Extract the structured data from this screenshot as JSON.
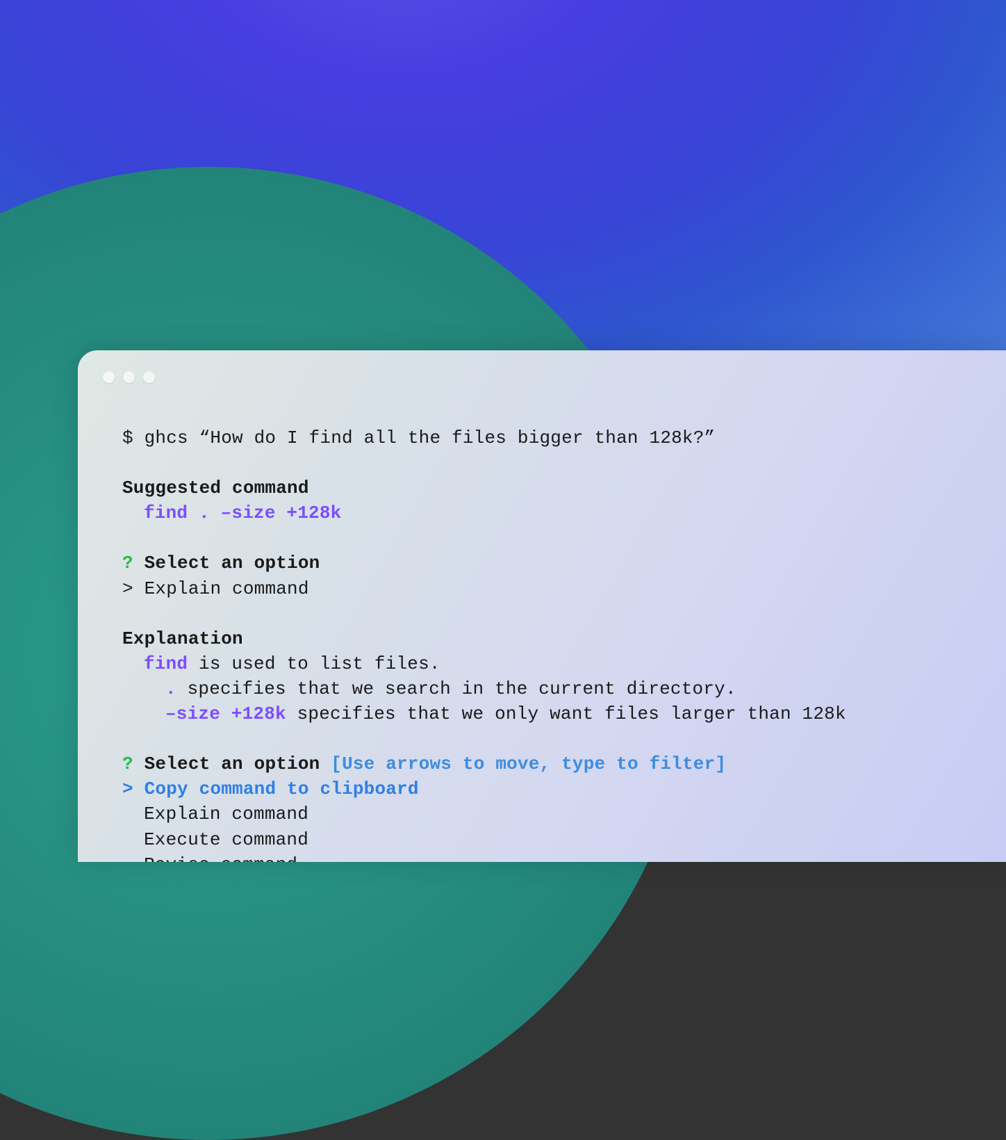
{
  "prompt_line": "$ ghcs “How do I find all the files bigger than 128k?”",
  "suggested": {
    "heading": "Suggested command",
    "command": "find . –size +128k"
  },
  "select1": {
    "q": "?",
    "label": "Select an option",
    "cursor": ">",
    "choice": "Explain command"
  },
  "explanation": {
    "heading": "Explanation",
    "l1_cmd": "find",
    "l1_text": " is used to list files.",
    "l2_cmd": ".",
    "l2_text": " specifies that we search in the current directory.",
    "l3_cmd": "–size +128k",
    "l3_text": " specifies that we only want files larger than 128k"
  },
  "select2": {
    "q": "?",
    "label": "Select an option",
    "hint": "[Use arrows to move, type to filter]",
    "cursor": ">",
    "selected": "Copy command to clipboard",
    "opt2": "Explain command",
    "opt3": "Execute command",
    "opt4": "Revise command"
  }
}
